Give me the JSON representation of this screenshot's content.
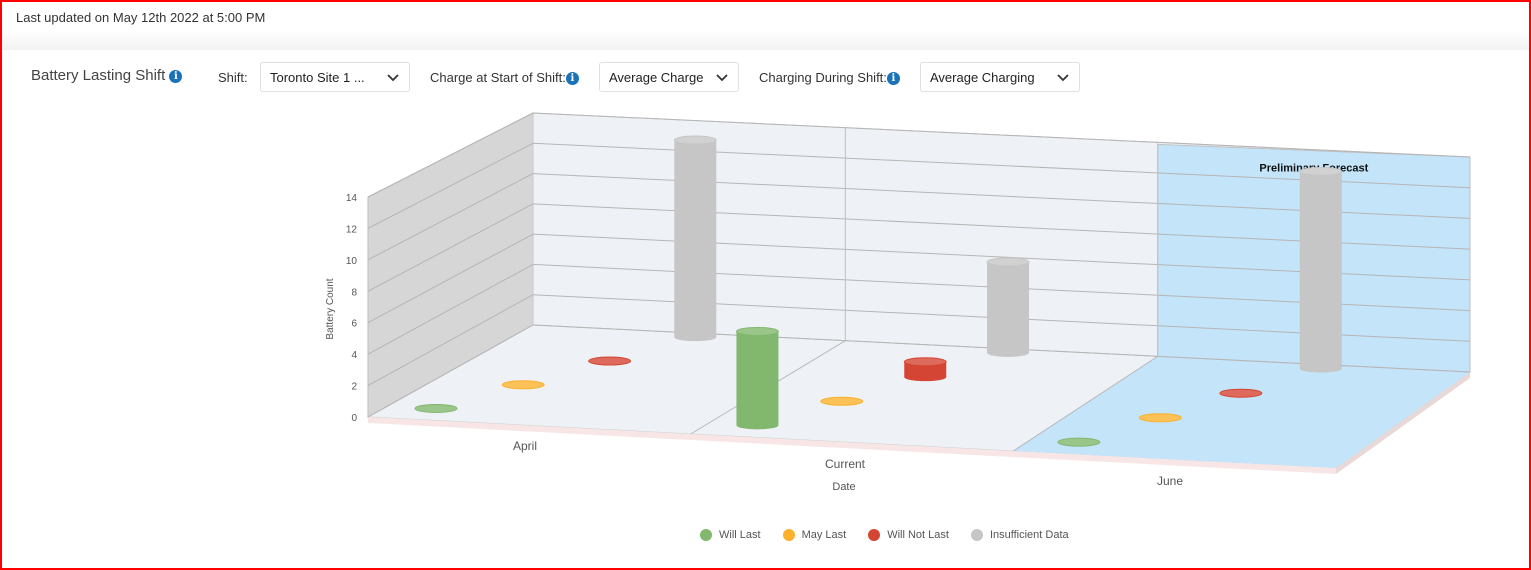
{
  "header": {
    "last_updated": "Last updated on May 12th 2022 at 5:00 PM"
  },
  "panel": {
    "title": "Battery Lasting Shift",
    "info_icon": "info-icon",
    "filters": [
      {
        "label": "Shift:",
        "value": "Toronto Site 1 ...",
        "has_info": false
      },
      {
        "label": "Charge at Start of Shift:",
        "value": "Average Charge",
        "has_info": true
      },
      {
        "label": "Charging During Shift:",
        "value": "Average Charging",
        "has_info": true
      }
    ]
  },
  "colors": {
    "will_last": "#82b86d",
    "may_last": "#fbb12d",
    "will_not_last": "#d54533",
    "insufficient": "#c6c6c6",
    "forecast_bg": "#c4e4fa",
    "wall": "#eef2f7",
    "side_wall": "#d6d6d6"
  },
  "chart_data": {
    "type": "bar",
    "subtype": "3d-cylinder",
    "title": "",
    "xlabel": "Date",
    "ylabel": "Battery Count",
    "categories": [
      "April",
      "Current",
      "June"
    ],
    "ylim": [
      0,
      14
    ],
    "yticks": [
      0,
      2,
      4,
      6,
      8,
      10,
      12,
      14
    ],
    "grid": true,
    "legend_position": "bottom",
    "annotations": [
      {
        "category": "June",
        "text": "Preliminary Forecast",
        "highlight": true
      }
    ],
    "series": [
      {
        "name": "Will Last",
        "color": "#82b86d",
        "values": [
          0,
          6,
          0
        ]
      },
      {
        "name": "May Last",
        "color": "#fbb12d",
        "values": [
          0,
          0,
          0
        ]
      },
      {
        "name": "Will Not Last",
        "color": "#d54533",
        "values": [
          0,
          1,
          0
        ]
      },
      {
        "name": "Insufficient Data",
        "color": "#c6c6c6",
        "values": [
          13,
          6,
          13
        ]
      }
    ]
  }
}
